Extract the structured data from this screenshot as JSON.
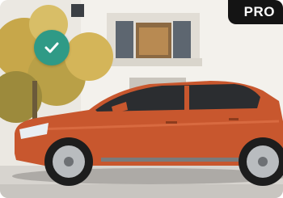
{
  "badge": {
    "label": "PRO"
  },
  "status": {
    "icon": "checkmark-icon",
    "color": "#2f9a86"
  },
  "photo": {
    "subject": "orange-hatchback-car",
    "car_color": "#c8572e"
  }
}
